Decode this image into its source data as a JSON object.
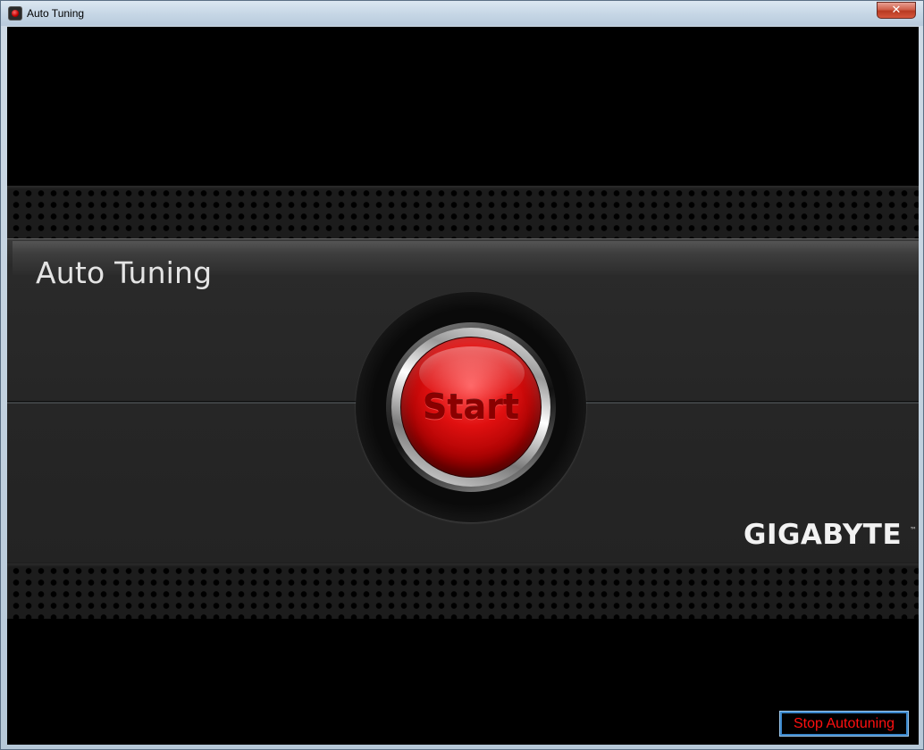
{
  "window": {
    "title": "Auto Tuning",
    "icon": "app-red-dot-icon",
    "close_label": "✕"
  },
  "panel": {
    "title": "Auto Tuning",
    "start_label": "Start",
    "logo_text": "GIGABYTE",
    "logo_tm": "™"
  },
  "footer": {
    "stop_label": "Stop Autotuning"
  },
  "colors": {
    "start_button": "#d00000",
    "stop_text": "#ff1010",
    "stop_border": "#3a86c9",
    "background": "#000000"
  }
}
